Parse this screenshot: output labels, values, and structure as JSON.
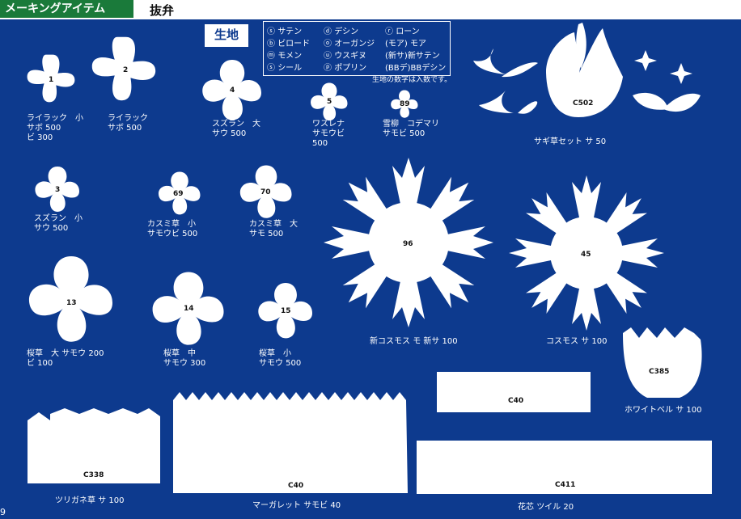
{
  "header": {
    "section": "メーキングアイテム",
    "title": "抜弁"
  },
  "fabric": {
    "title": "生地",
    "items": [
      {
        "mark": "サ",
        "name": "サテン"
      },
      {
        "mark": "デ",
        "name": "デシン"
      },
      {
        "mark": "ロ",
        "name": "ローン"
      },
      {
        "mark": "ビ",
        "name": "ビロード"
      },
      {
        "mark": "オ",
        "name": "オーガンジ"
      },
      {
        "mark": "モア",
        "name": "モア"
      },
      {
        "mark": "モ",
        "name": "モメン"
      },
      {
        "mark": "ウ",
        "name": "ウスギヌ"
      },
      {
        "mark": "新サ",
        "name": "新サテン"
      },
      {
        "mark": "シ",
        "name": "シール"
      },
      {
        "mark": "ポ",
        "name": "ポプリン"
      },
      {
        "mark": "BBデ",
        "name": "BBデシン"
      }
    ],
    "note": "生地の数字は入数です。"
  },
  "items": [
    {
      "num": "1",
      "name": "ライラック　小",
      "l1": "サボ 500",
      "l2": "ビ 300"
    },
    {
      "num": "2",
      "name": "ライラック",
      "l1": "サボ 500"
    },
    {
      "num": "4",
      "name": "スズラン　大",
      "l1": "サウ 500"
    },
    {
      "num": "5",
      "name": "ワスレナ",
      "l1": "サモウビ",
      "l2": "500"
    },
    {
      "num": "89",
      "name": "雪柳　コデマリ",
      "l1": "サモビ 500"
    },
    {
      "num": "C502",
      "name": "サギ草セット",
      "l1": "サ 50"
    },
    {
      "num": "3",
      "name": "スズラン　小",
      "l1": "サウ 500"
    },
    {
      "num": "69",
      "name": "カスミ草　小",
      "l1": "サモウビ 500"
    },
    {
      "num": "70",
      "name": "カスミ草　大",
      "l1": "サモ 500"
    },
    {
      "num": "96",
      "name": "新コスモス",
      "l1": "モ 新サ 100"
    },
    {
      "num": "45",
      "name": "コスモス",
      "l1": "サ 100"
    },
    {
      "num": "13",
      "name": "桜草　大",
      "l1": "サモウ 200",
      "l2": "ビ 100"
    },
    {
      "num": "14",
      "name": "桜草　中",
      "l1": "サモウ 300"
    },
    {
      "num": "15",
      "name": "桜草　小",
      "l1": "サモウ 500"
    },
    {
      "num": "C385",
      "name": "ホワイトベル",
      "l1": "サ 100"
    },
    {
      "num": "C40",
      "name": "",
      "l1": ""
    },
    {
      "num": "C338",
      "name": "ツリガネ草",
      "l1": "サ 100"
    },
    {
      "num": "C40",
      "name": "マーガレット",
      "l1": "サモビ 40"
    },
    {
      "num": "C411",
      "name": "花芯",
      "l1": "ツイル 20"
    }
  ],
  "page_number": "9"
}
